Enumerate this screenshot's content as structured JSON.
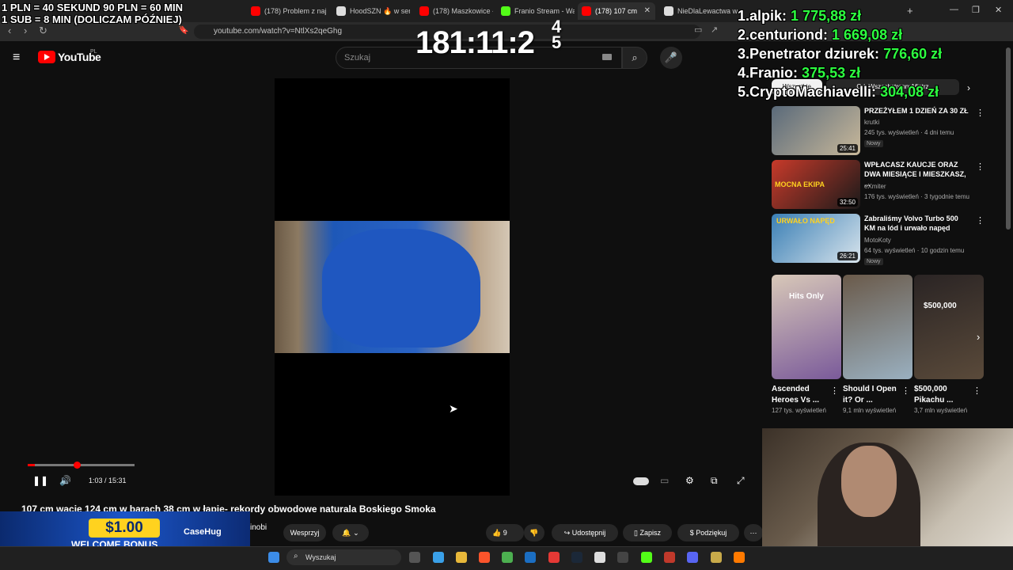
{
  "browser": {
    "tabs": [
      {
        "label": "(178) Problem z naj",
        "color": "#ff0000"
      },
      {
        "label": "HoodSZN 🔥 w serw",
        "color": "#dddddd"
      },
      {
        "label": "(178) Maszkowice -",
        "color": "#ff0000"
      },
      {
        "label": "Franio Stream - Wa",
        "color": "#53fc18"
      },
      {
        "label": "(178) 107 cm",
        "color": "#ff0000"
      },
      {
        "label": "NieDlaLewactwa w",
        "color": "#dddddd"
      }
    ],
    "url": "youtube.com/watch?v=NtlXs2qeGhg",
    "new_tab": "+",
    "tab_close": "✕"
  },
  "youtube": {
    "logo_text": "YouTube",
    "country": "PL",
    "search_placeholder": "Szukaj"
  },
  "player": {
    "time": "1:03 / 15:31",
    "progress_fraction": 0.068,
    "buffered_fraction": 0.15,
    "title": "107 cm wacie 124 cm w barach 38 cm w łapie- rekordy obwodowe naturala Boskiego Smoka",
    "channel": "inobi"
  },
  "actions": {
    "support": "Wesprzyj",
    "likes": "9",
    "share": "Udostępnij",
    "save": "Zapisz",
    "thanks": "Podziękuj"
  },
  "overlay": {
    "rules_line1": "1 PLN = 40 SEKUND 90 PLN = 60 MIN",
    "rules_line2": "1 SUB = 8 MIN (DOLICZAM PÓŹNIEJ)",
    "timer": "181:11:2",
    "timer_next_top": "4",
    "timer_next_bottom": "5",
    "leaderboard": [
      {
        "rank": "1.",
        "name": "alpik:",
        "amount": "1 775,88 zł"
      },
      {
        "rank": "2.",
        "name": "centuriond:",
        "amount": "1 669,08 zł"
      },
      {
        "rank": "3.",
        "name": "Penetrator dziurek:",
        "amount": "776,60 zł"
      },
      {
        "rank": "4.",
        "name": "Franio:",
        "amount": "375,53 zł"
      },
      {
        "rank": "5.",
        "name": "CryptoMachiavelli:",
        "amount": "304,08 zł"
      }
    ]
  },
  "sidebar": {
    "chips": [
      "Wszystkie",
      "Od: WszechstronnyMistrz"
    ],
    "videos": [
      {
        "title": "PRZEŻYŁEM 1 DZIEŃ ZA 30 ZŁ",
        "channel": "krutki",
        "meta": "245 tys. wyświetleń · 4 dni temu",
        "badge": "Nowy",
        "duration": "25:41",
        "thumb_color": "#7a8f9e"
      },
      {
        "title": "WPŁACASZ KAUCJE ORAZ DWA MIESIĄCE I MIESZKASZ, ...",
        "channel": "eXmiter",
        "meta": "176 tys. wyświetleń · 3 tygodnie temu",
        "badge": "",
        "duration": "32:50",
        "thumb_color": "#c83a2a"
      },
      {
        "title": "Zabraliśmy Volvo Turbo 500 KM na lód i urwało napęd",
        "channel": "MotoKoty",
        "meta": "64 tys. wyświetleń · 10 godzin temu",
        "badge": "Nowy",
        "duration": "26:21",
        "thumb_color": "#3a7fb5"
      }
    ],
    "shorts": [
      {
        "title": "Ascended Heroes Vs ...",
        "views": "127 tys. wyświetleń",
        "thumb_color": "#8a6a9a"
      },
      {
        "title": "Should I Open it? Or ...",
        "views": "9,1 mln wyświetleń",
        "thumb_color": "#7a8a9a"
      },
      {
        "title": "$500,000 Pikachu ...",
        "views": "3,7 mln wyświetleń",
        "thumb_color": "#3a3030"
      }
    ],
    "thumb_labels": {
      "v2": "MOCNA EKIPA",
      "v3": "URWAŁO NAPĘD",
      "s1": "Hits Only",
      "s3": "$500,000"
    }
  },
  "casino": {
    "amount": "$1.00",
    "bonus": "WELCOME BONUS",
    "brand": "CaseHug"
  },
  "taskbar": {
    "search": "Wyszukaj"
  }
}
